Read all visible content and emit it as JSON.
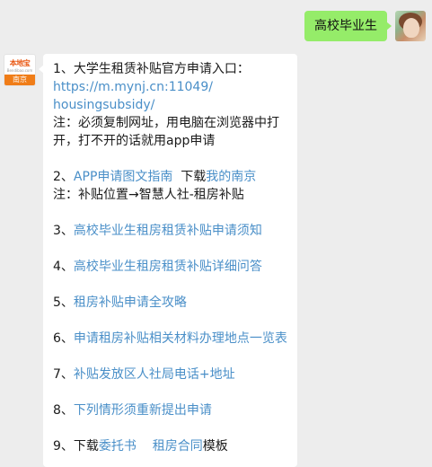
{
  "chat": {
    "outgoing": {
      "text": "高校毕业生"
    },
    "sender_logo": {
      "title": "本地宝",
      "subtitle": "Bendibao.com",
      "city": "南京"
    },
    "incoming": {
      "item1": {
        "prefix": "1、大学生租赁补贴官方申请入口：",
        "url_line1": "https://m.mynj.cn:11049/",
        "url_line2": "housingsubsidy/",
        "note_line1": "注：必须复制网址，用电脑在浏览器中打",
        "note_line2": "开，打不开的话就用app申请"
      },
      "item2": {
        "num": "2、",
        "link1": "APP申请图文指南",
        "text": "  下载",
        "link2": "我的南京",
        "note": "注：补贴位置→智慧人社-租房补贴"
      },
      "item3": {
        "num": "3、",
        "link": "高校毕业生租房租赁补贴申请须知"
      },
      "item4": {
        "num": "4、",
        "link": "高校毕业生租房租赁补贴详细问答"
      },
      "item5": {
        "num": "5、",
        "link": "租房补贴申请全攻略"
      },
      "item6": {
        "num": "6、",
        "link": "申请租房补贴相关材料办理地点一览表"
      },
      "item7": {
        "num": "7、",
        "link": "补贴发放区人社局电话+地址"
      },
      "item8": {
        "num": "8、",
        "link": "下列情形须重新提出申请"
      },
      "item9": {
        "num": "9、",
        "text1": "下载",
        "link1": "委托书",
        "spacer": "    ",
        "link2": "租房合同",
        "text2": "模板"
      }
    }
  },
  "colors": {
    "bubble_out": "#95ec69",
    "link": "#4a8fc8",
    "background": "#ededed"
  }
}
